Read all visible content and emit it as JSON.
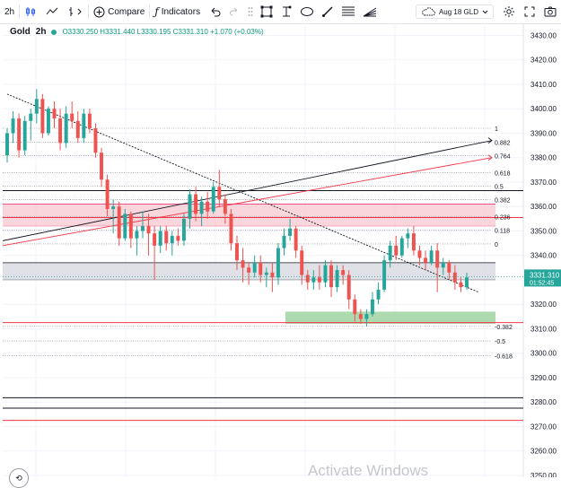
{
  "toolbar": {
    "interval": "2h",
    "compare_label": "Compare",
    "indicators_label": "Indicators",
    "goto_label": "Aug 18 GLD"
  },
  "legend": {
    "symbol": "Gold",
    "interval": "2h",
    "ohlc": "O3330.250 H3331.440 L3330.195 C3331.310 +1.070 (+0.03%)"
  },
  "watermark": "Activate Windows",
  "chart_data": {
    "type": "candlestick",
    "symbol": "Gold",
    "interval": "2h",
    "ylim": [
      3250,
      3432
    ],
    "y_ticks": [
      3430,
      3420,
      3410,
      3400,
      3390,
      3380,
      3370,
      3360,
      3350,
      3340,
      3330,
      3320,
      3310,
      3300,
      3290,
      3280,
      3270,
      3260,
      3250
    ],
    "last_price": {
      "value": "3331.310",
      "countdown": "01:52:45",
      "color": "#26a69a"
    },
    "candles": [
      [
        3381,
        3392,
        3378,
        3390
      ],
      [
        3390,
        3399,
        3386,
        3396
      ],
      [
        3396,
        3398,
        3380,
        3383
      ],
      [
        3383,
        3397,
        3381,
        3395
      ],
      [
        3395,
        3400,
        3387,
        3398
      ],
      [
        3398,
        3408,
        3394,
        3404
      ],
      [
        3404,
        3406,
        3388,
        3390
      ],
      [
        3390,
        3401,
        3389,
        3400
      ],
      [
        3400,
        3403,
        3392,
        3396
      ],
      [
        3396,
        3400,
        3383,
        3386
      ],
      [
        3386,
        3401,
        3384,
        3398
      ],
      [
        3398,
        3403,
        3392,
        3395
      ],
      [
        3395,
        3399,
        3386,
        3388
      ],
      [
        3388,
        3400,
        3386,
        3398
      ],
      [
        3398,
        3400,
        3390,
        3392
      ],
      [
        3392,
        3394,
        3380,
        3382
      ],
      [
        3382,
        3384,
        3368,
        3371
      ],
      [
        3371,
        3373,
        3356,
        3359
      ],
      [
        3359,
        3363,
        3349,
        3360
      ],
      [
        3360,
        3362,
        3344,
        3347
      ],
      [
        3347,
        3359,
        3346,
        3357
      ],
      [
        3357,
        3358,
        3343,
        3347
      ],
      [
        3347,
        3352,
        3340,
        3350
      ],
      [
        3350,
        3358,
        3347,
        3352
      ],
      [
        3352,
        3357,
        3340,
        3349
      ],
      [
        3349,
        3352,
        3330,
        3344
      ],
      [
        3344,
        3352,
        3341,
        3350
      ],
      [
        3350,
        3352,
        3342,
        3345
      ],
      [
        3345,
        3350,
        3340,
        3348
      ],
      [
        3348,
        3351,
        3344,
        3346
      ],
      [
        3346,
        3357,
        3344,
        3355
      ],
      [
        3355,
        3367,
        3351,
        3365
      ],
      [
        3365,
        3368,
        3354,
        3357
      ],
      [
        3357,
        3364,
        3352,
        3362
      ],
      [
        3362,
        3366,
        3355,
        3358
      ],
      [
        3358,
        3370,
        3357,
        3368
      ],
      [
        3368,
        3375,
        3360,
        3363
      ],
      [
        3363,
        3365,
        3353,
        3357
      ],
      [
        3357,
        3359,
        3342,
        3345
      ],
      [
        3345,
        3348,
        3334,
        3338
      ],
      [
        3338,
        3343,
        3329,
        3335
      ],
      [
        3335,
        3337,
        3328,
        3333
      ],
      [
        3333,
        3340,
        3331,
        3337
      ],
      [
        3337,
        3340,
        3329,
        3332
      ],
      [
        3332,
        3335,
        3327,
        3333
      ],
      [
        3333,
        3337,
        3325,
        3331
      ],
      [
        3331,
        3345,
        3328,
        3343
      ],
      [
        3343,
        3351,
        3340,
        3348
      ],
      [
        3348,
        3355,
        3346,
        3351
      ],
      [
        3351,
        3352,
        3339,
        3342
      ],
      [
        3342,
        3344,
        3328,
        3332
      ],
      [
        3332,
        3334,
        3326,
        3329
      ],
      [
        3329,
        3334,
        3326,
        3331
      ],
      [
        3331,
        3336,
        3326,
        3329
      ],
      [
        3329,
        3338,
        3327,
        3336
      ],
      [
        3336,
        3338,
        3323,
        3327
      ],
      [
        3327,
        3336,
        3325,
        3334
      ],
      [
        3334,
        3336,
        3328,
        3332
      ],
      [
        3332,
        3334,
        3318,
        3322
      ],
      [
        3322,
        3324,
        3313,
        3316
      ],
      [
        3316,
        3318,
        3312,
        3314
      ],
      [
        3314,
        3318,
        3311,
        3316
      ],
      [
        3316,
        3325,
        3315,
        3322
      ],
      [
        3322,
        3329,
        3320,
        3326
      ],
      [
        3326,
        3340,
        3325,
        3338
      ],
      [
        3338,
        3346,
        3335,
        3344
      ],
      [
        3344,
        3348,
        3338,
        3340
      ],
      [
        3340,
        3348,
        3339,
        3347
      ],
      [
        3347,
        3351,
        3343,
        3349
      ],
      [
        3349,
        3352,
        3340,
        3342
      ],
      [
        3342,
        3344,
        3336,
        3339
      ],
      [
        3339,
        3342,
        3334,
        3337
      ],
      [
        3337,
        3344,
        3336,
        3342
      ],
      [
        3342,
        3345,
        3325,
        3335
      ],
      [
        3335,
        3339,
        3332,
        3337
      ],
      [
        3337,
        3338,
        3330,
        3333
      ],
      [
        3333,
        3336,
        3326,
        3329
      ],
      [
        3329,
        3331,
        3325,
        3327
      ],
      [
        3327,
        3333,
        3326,
        3331
      ]
    ],
    "fibonacci": {
      "levels": [
        {
          "label": "1",
          "value": 3392
        },
        {
          "label": "0.882",
          "value": 3386.4
        },
        {
          "label": "0.764",
          "value": 3380.8
        },
        {
          "label": "0.618",
          "value": 3373.9
        },
        {
          "label": "0.5",
          "value": 3368.3
        },
        {
          "label": "0.382",
          "value": 3362.8
        },
        {
          "label": "0.236",
          "value": 3355.9
        },
        {
          "label": "0.118",
          "value": 3350.3
        },
        {
          "label": "0",
          "value": 3344.7
        },
        {
          "label": "-0.382",
          "value": 3311
        },
        {
          "label": "-0.5",
          "value": 3305
        },
        {
          "label": "-0.618",
          "value": 3299
        }
      ]
    },
    "zones": [
      {
        "top": 3361,
        "bottom": 3352,
        "color": "#f7c5cc",
        "edge": "#e91e63"
      },
      {
        "top": 3337,
        "bottom": 3330,
        "color": "#d1d4dc",
        "edge": "#131722"
      },
      {
        "top": 3317,
        "bottom": 3312,
        "color": "#a5d6a7",
        "edge": "#81c784"
      }
    ],
    "horizontal_lines": [
      {
        "value": 3355.5,
        "color": "#f23645"
      },
      {
        "value": 3312.5,
        "color": "#f23645"
      },
      {
        "value": 3281.8,
        "color": "#131722"
      },
      {
        "value": 3277.5,
        "color": "#131722"
      },
      {
        "value": 3272.5,
        "color": "#f23645"
      },
      {
        "value": 3366.5,
        "color": "#131722"
      }
    ],
    "trendlines": [
      {
        "from": [
          3406,
          0
        ],
        "to": [
          3325,
          1
        ],
        "color": "#131722"
      },
      {
        "from": [
          3346,
          0
        ],
        "to": [
          3387,
          1
        ],
        "color": "#131722"
      },
      {
        "from": [
          3344,
          0
        ],
        "to": [
          3380,
          1
        ],
        "color": "#f23645"
      }
    ],
    "colors": {
      "up": "#26a69a",
      "down": "#ef5350",
      "last_price": "#26a69a"
    }
  }
}
